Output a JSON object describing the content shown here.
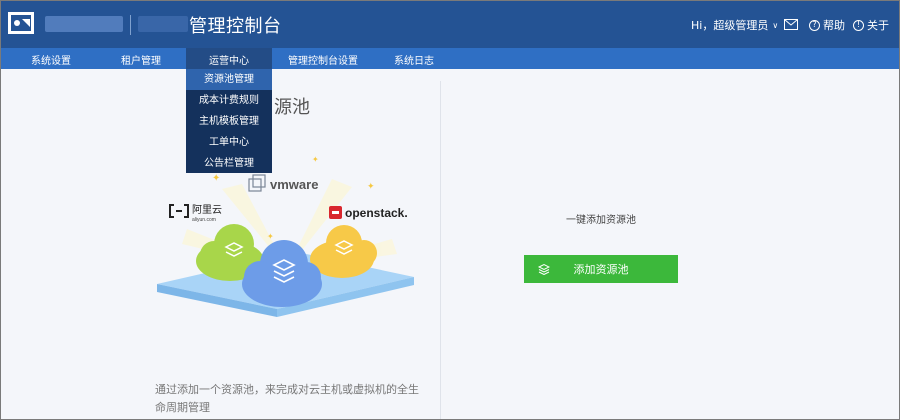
{
  "header": {
    "app_title": "管理控制台",
    "greeting": "Hi，超级管理员",
    "help_label": "帮助",
    "about_label": "关于"
  },
  "nav": {
    "items": [
      "系统设置",
      "租户管理",
      "运营中心",
      "管理控制台设置",
      "系统日志"
    ],
    "active_index": 2
  },
  "dropdown": {
    "items": [
      "资源池管理",
      "成本计费规则",
      "主机模板管理",
      "工单中心",
      "公告栏管理"
    ],
    "selected_index": 0
  },
  "main": {
    "title_visible": "源池",
    "description": "通过添加一个资源池，来完成对云主机或虚拟机的全生命周期管理",
    "add_hint": "一键添加资源池",
    "add_button_label": "添加资源池",
    "logos": {
      "vmware": "vmware",
      "aliyun": "阿里云",
      "aliyun_sub": "aliyun.com",
      "openstack": "openstack."
    }
  },
  "colors": {
    "header_bg": "#245394",
    "nav_bg": "#2f6fc4",
    "dropdown_bg": "#14315c",
    "button_green": "#3cb83b"
  }
}
